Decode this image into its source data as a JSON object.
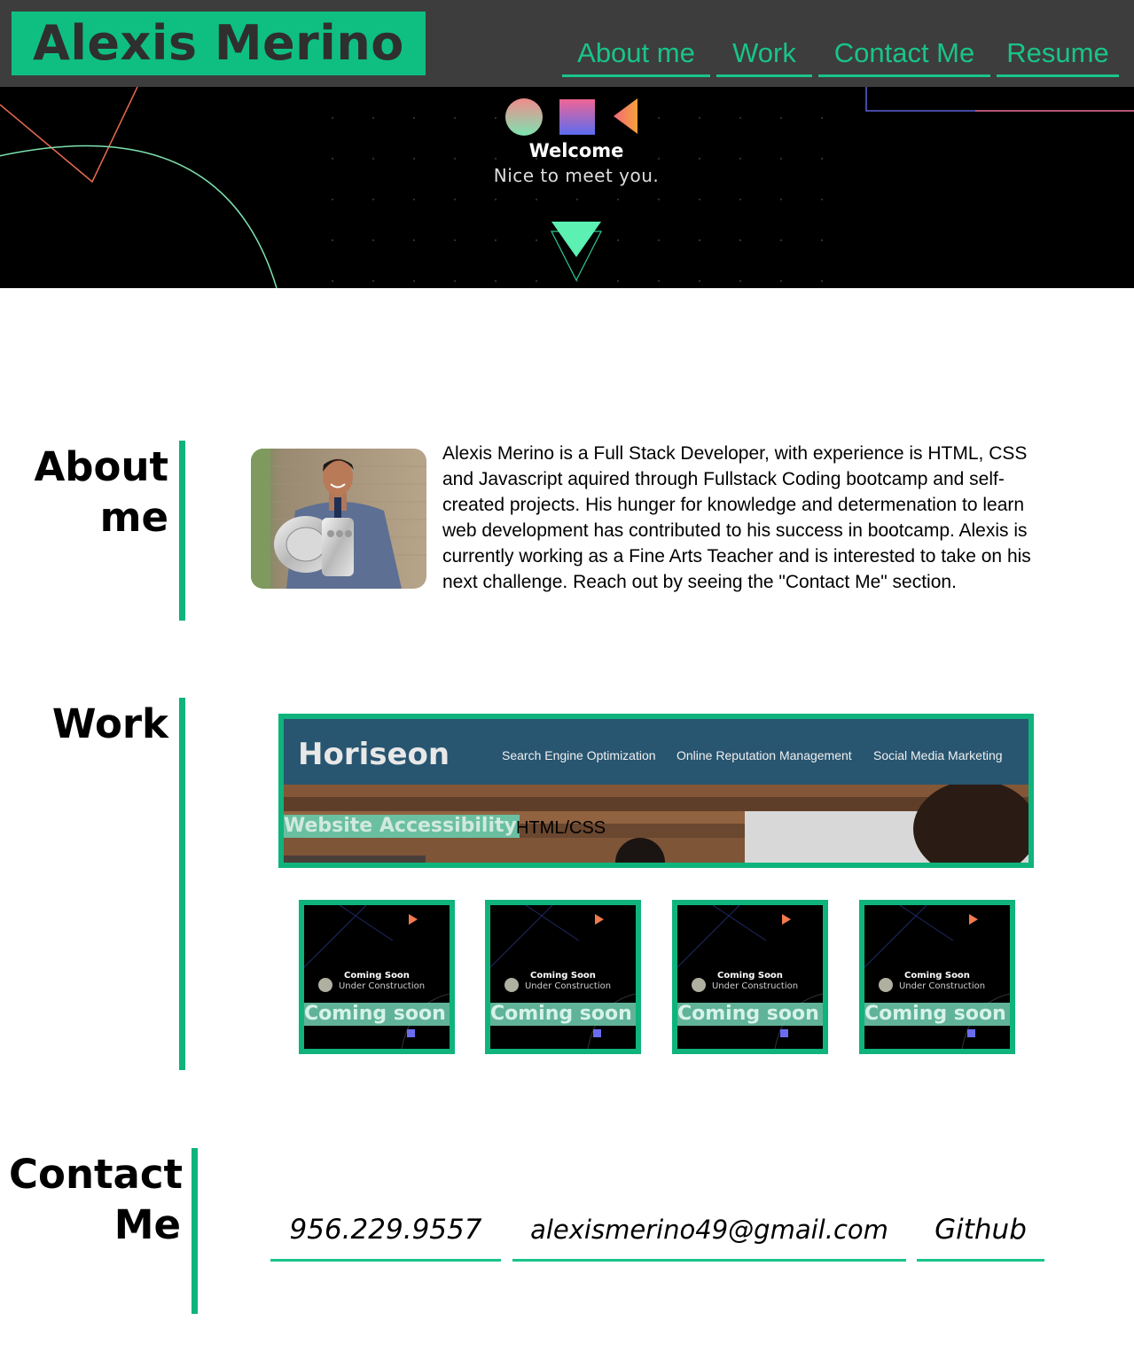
{
  "header": {
    "name": "Alexis Merino",
    "nav": [
      {
        "label": "About me"
      },
      {
        "label": "Work"
      },
      {
        "label": "Contact Me"
      },
      {
        "label": "Resume"
      }
    ]
  },
  "hero": {
    "welcome": "Welcome",
    "greeting": "Nice to meet you."
  },
  "about": {
    "heading_line1": "About",
    "heading_line2": "me",
    "bio": "Alexis Merino is a Full Stack Developer, with experience is HTML, CSS and Javascript aquired through Fullstack Coding bootcamp and self-created projects. His hunger for knowledge and determenation to learn web development has contributed to his success in bootcamp. Alexis is currently working as a Fine Arts Teacher and is interested to take on his next challenge. Reach out by seeing the \"Contact Me\" section."
  },
  "work": {
    "heading": "Work",
    "featured": {
      "site_logo": "Horiseon",
      "site_nav": [
        "Search Engine Optimization",
        "Online Reputation Management",
        "Social Media Marketing"
      ],
      "title": "Website Accessibility",
      "tech": "HTML/CSS"
    },
    "placeholders": [
      {
        "thumb_title": "Coming Soon",
        "thumb_subtitle": "Under Construction",
        "label": "Coming soon"
      },
      {
        "thumb_title": "Coming Soon",
        "thumb_subtitle": "Under Construction",
        "label": "Coming soon"
      },
      {
        "thumb_title": "Coming Soon",
        "thumb_subtitle": "Under Construction",
        "label": "Coming soon"
      },
      {
        "thumb_title": "Coming Soon",
        "thumb_subtitle": "Under Construction",
        "label": "Coming soon"
      }
    ]
  },
  "contact": {
    "heading_line1": "Contact",
    "heading_line2": "Me",
    "phone": "956.229.9557",
    "email": "alexismerino49@gmail.com",
    "github": "Github"
  },
  "colors": {
    "accent": "#0fb37c",
    "header_bg": "#3d3d3d",
    "hero_bg": "#000000"
  },
  "icons": [
    "circle-shape-icon",
    "square-shape-icon",
    "triangle-shape-icon",
    "scroll-down-arrow-icon"
  ]
}
